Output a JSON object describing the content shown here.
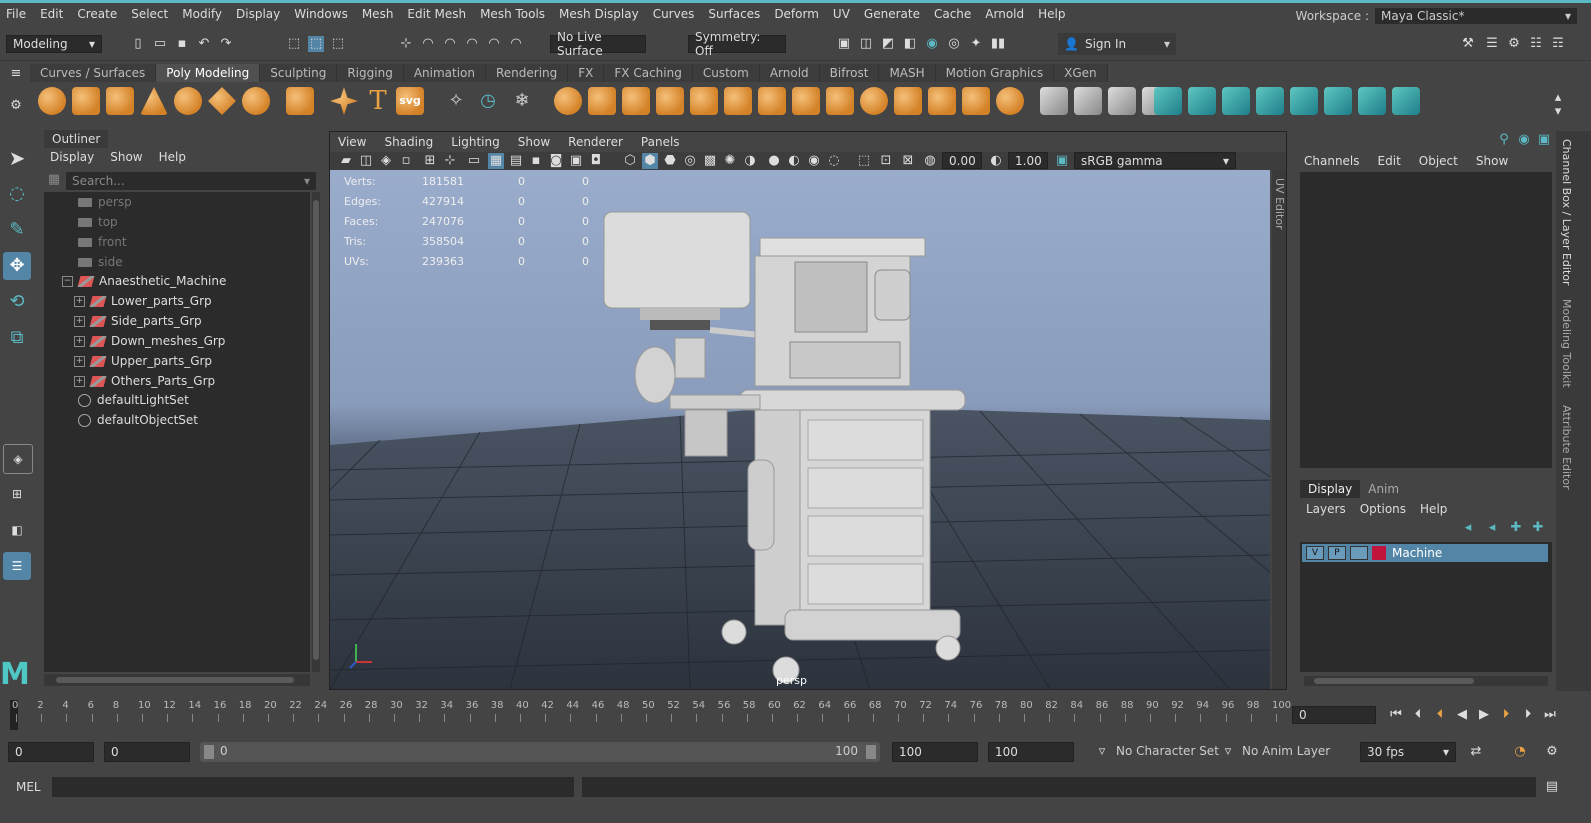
{
  "menubar": {
    "items": [
      "File",
      "Edit",
      "Create",
      "Select",
      "Modify",
      "Display",
      "Windows",
      "Mesh",
      "Edit Mesh",
      "Mesh Tools",
      "Mesh Display",
      "Curves",
      "Surfaces",
      "Deform",
      "UV",
      "Generate",
      "Cache",
      "Arnold",
      "Help"
    ]
  },
  "workspace": {
    "label": "Workspace :",
    "value": "Maya Classic*"
  },
  "status": {
    "mode": "Modeling",
    "live_surface": "No Live Surface",
    "symmetry": "Symmetry: Off",
    "sign_in": "Sign In"
  },
  "shelf": {
    "tabs": [
      "Curves / Surfaces",
      "Poly Modeling",
      "Sculpting",
      "Rigging",
      "Animation",
      "Rendering",
      "FX",
      "FX Caching",
      "Custom",
      "Arnold",
      "Bifrost",
      "MASH",
      "Motion Graphics",
      "XGen"
    ],
    "active_tab": "Poly Modeling",
    "text_tools": {
      "type": "T",
      "svg": "svg"
    }
  },
  "outliner": {
    "title": "Outliner",
    "menu": [
      "Display",
      "Show",
      "Help"
    ],
    "search_placeholder": "Search...",
    "cameras": [
      "persp",
      "top",
      "front",
      "side"
    ],
    "root": "Anaesthetic_Machine",
    "groups": [
      "Lower_parts_Grp",
      "Side_parts_Grp",
      "Down_meshes_Grp",
      "Upper_parts_Grp",
      "Others_Parts_Grp"
    ],
    "sets": [
      "defaultLightSet",
      "defaultObjectSet"
    ]
  },
  "viewport": {
    "menu": [
      "View",
      "Shading",
      "Lighting",
      "Show",
      "Renderer",
      "Panels"
    ],
    "exposure": "0.00",
    "gamma": "1.00",
    "color_space": "sRGB gamma",
    "camera_label": "persp",
    "stats": [
      {
        "label": "Verts:",
        "value": "181581",
        "a": "0",
        "b": "0"
      },
      {
        "label": "Edges:",
        "value": "427914",
        "a": "0",
        "b": "0"
      },
      {
        "label": "Faces:",
        "value": "247076",
        "a": "0",
        "b": "0"
      },
      {
        "label": "Tris:",
        "value": "358504",
        "a": "0",
        "b": "0"
      },
      {
        "label": "UVs:",
        "value": "239363",
        "a": "0",
        "b": "0"
      }
    ]
  },
  "side_tabs": {
    "uv_editor": "UV Editor",
    "channel_box": "Channel Box / Layer Editor",
    "modeling_toolkit": "Modeling Toolkit",
    "attribute_editor": "Attribute Editor"
  },
  "channel_box": {
    "menu": [
      "Channels",
      "Edit",
      "Object",
      "Show"
    ]
  },
  "layer_editor": {
    "tabs": [
      "Display",
      "Anim"
    ],
    "active": "Display",
    "menu": [
      "Layers",
      "Options",
      "Help"
    ],
    "layer": {
      "v": "V",
      "p": "P",
      "name": "Machine",
      "color": "#c0143c"
    }
  },
  "timeline": {
    "ticks": [
      "0",
      "2",
      "4",
      "6",
      "8",
      "10",
      "12",
      "14",
      "16",
      "18",
      "20",
      "22",
      "24",
      "26",
      "28",
      "30",
      "32",
      "34",
      "36",
      "38",
      "40",
      "42",
      "44",
      "46",
      "48",
      "50",
      "52",
      "54",
      "56",
      "58",
      "60",
      "62",
      "64",
      "66",
      "68",
      "70",
      "72",
      "74",
      "76",
      "78",
      "80",
      "82",
      "84",
      "86",
      "88",
      "90",
      "92",
      "94",
      "96",
      "98",
      "100"
    ],
    "current": "0",
    "current_frame_field": "0"
  },
  "range": {
    "start": "0",
    "playback_start": "0",
    "slider_start": "0",
    "slider_end": "100",
    "playback_end": "100",
    "end": "100",
    "character_set": "No Character Set",
    "anim_layer": "No Anim Layer",
    "fps": "30 fps"
  },
  "command": {
    "label": "MEL"
  },
  "accent": "#5bb9c4"
}
